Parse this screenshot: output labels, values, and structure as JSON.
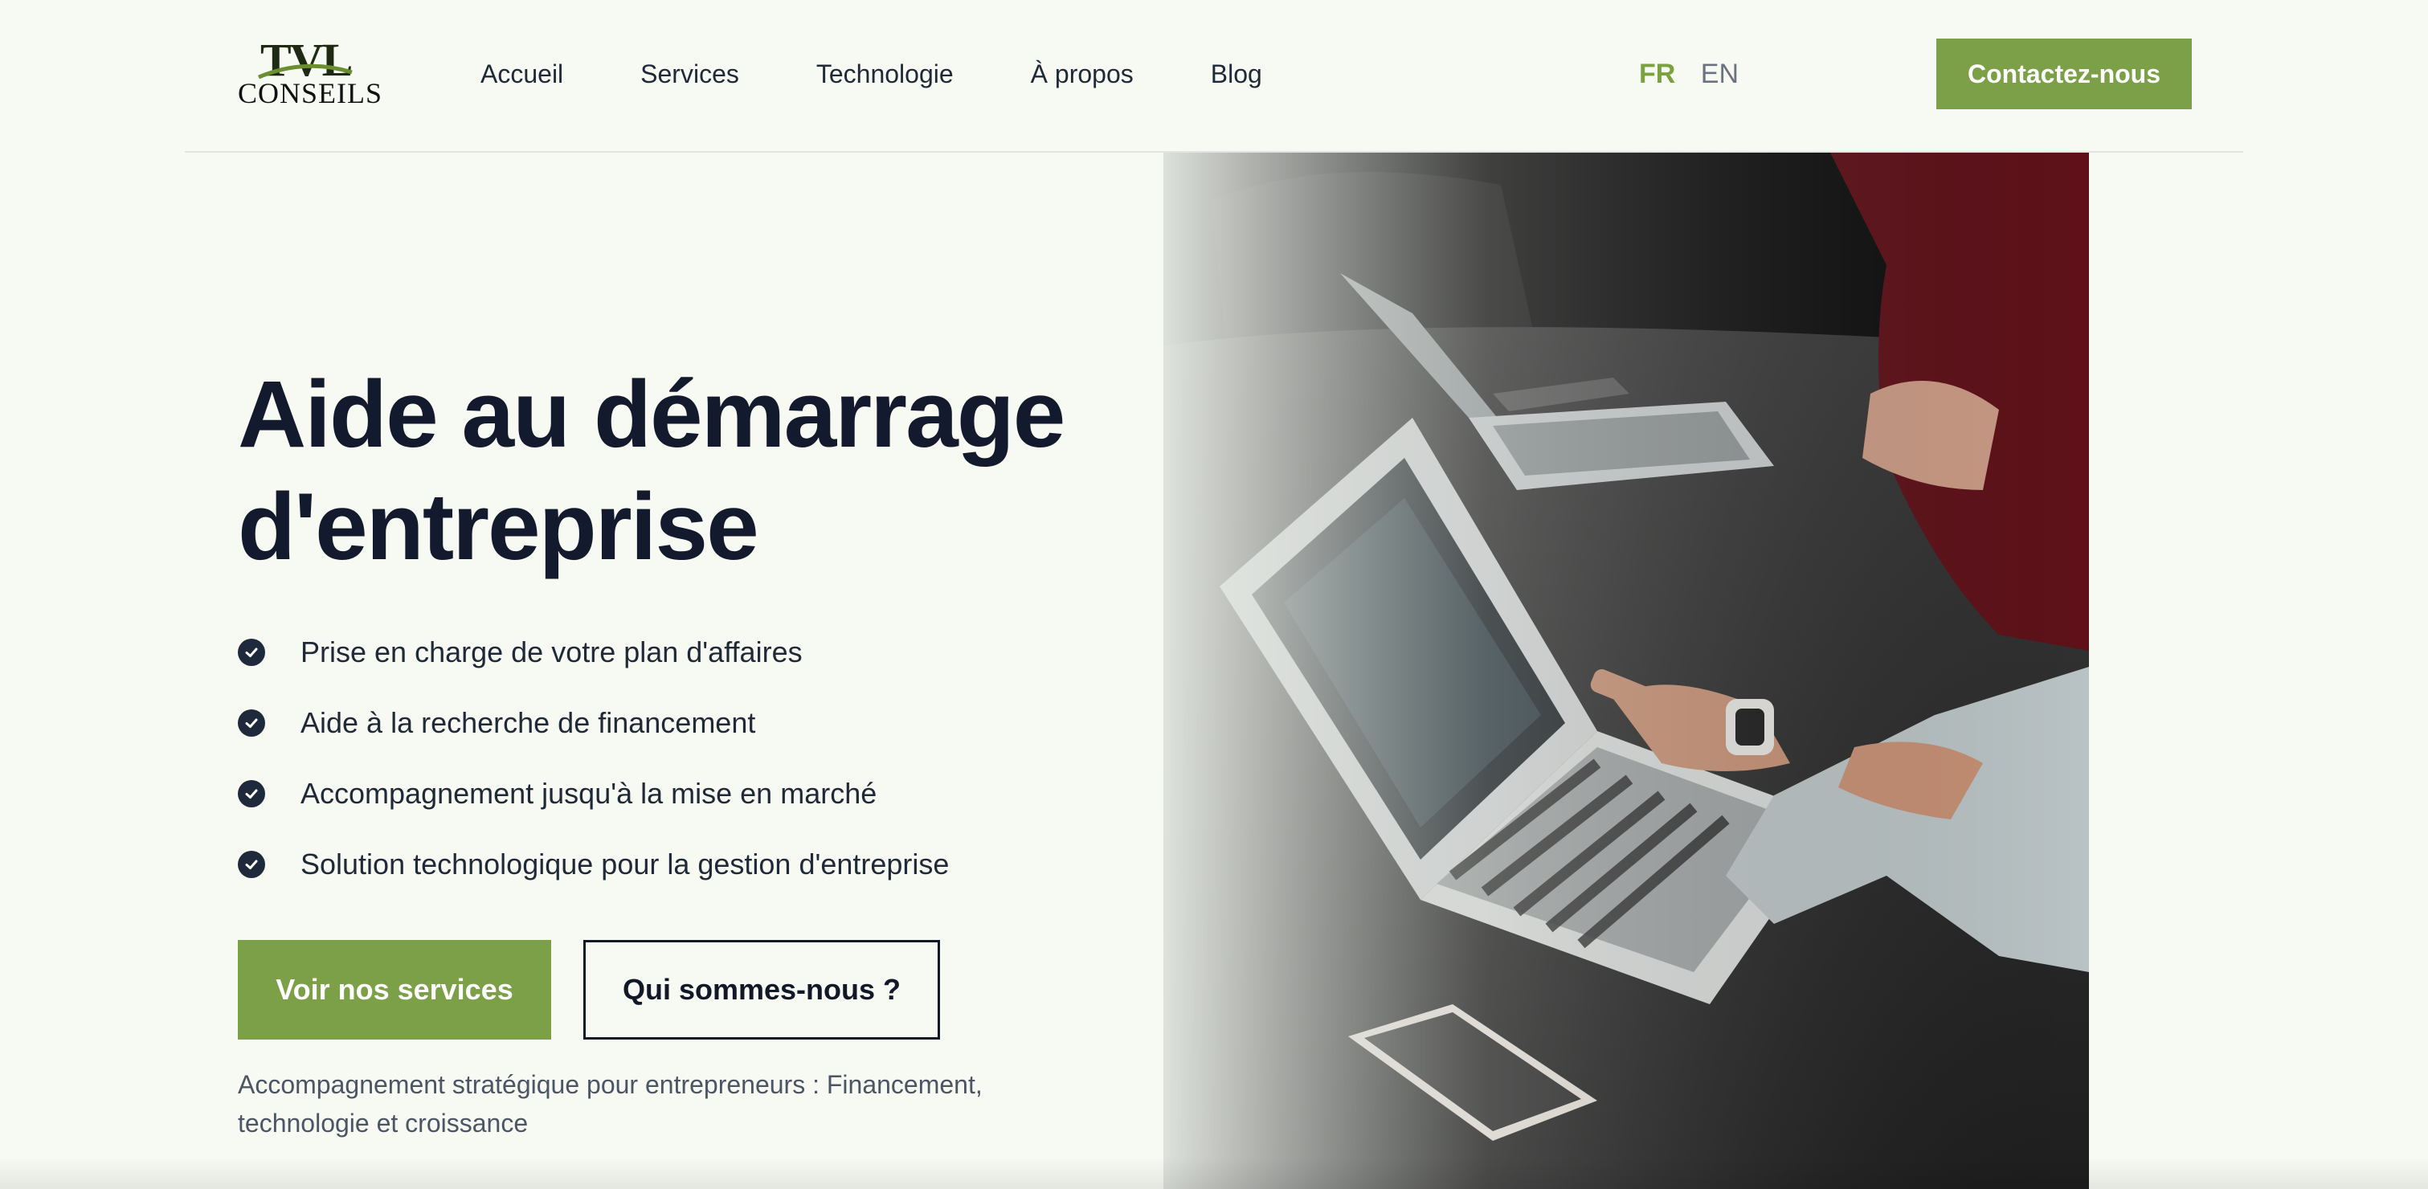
{
  "brand": {
    "logo_top": "TVL",
    "logo_bottom": "CONSEILS"
  },
  "nav": {
    "items": [
      {
        "label": "Accueil"
      },
      {
        "label": "Services"
      },
      {
        "label": "Technologie"
      },
      {
        "label": "À propos"
      },
      {
        "label": "Blog"
      }
    ]
  },
  "language": {
    "active": "FR",
    "other": "EN"
  },
  "header": {
    "contact_label": "Contactez-nous"
  },
  "hero": {
    "title_line1": "Aide au démarrage",
    "title_line2": "d'entreprise",
    "features": [
      "Prise en charge de votre plan d'affaires",
      "Aide à la recherche de financement",
      "Accompagnement jusqu'à la mise en marché",
      "Solution technologique pour la gestion d'entreprise"
    ],
    "primary_button": "Voir nos services",
    "secondary_button": "Qui sommes-nous ?",
    "tagline": "Accompagnement stratégique pour entrepreneurs : Financement, technologie et croissance"
  },
  "theme": {
    "accent": "#7ba047",
    "background": "#f7faf3",
    "heading": "#141a2e"
  },
  "icons": {
    "feature": "check-circle-icon",
    "logo": "tvl-logo"
  }
}
